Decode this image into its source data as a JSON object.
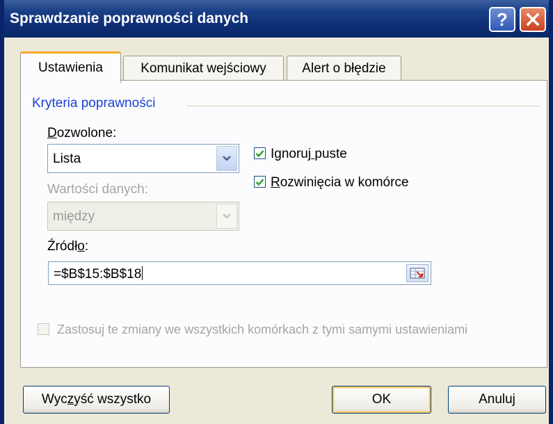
{
  "window": {
    "title": "Sprawdzanie poprawności danych",
    "help_icon": "help-icon",
    "close_icon": "close-icon"
  },
  "tabs": [
    {
      "label": "Ustawienia",
      "active": true
    },
    {
      "label": "Komunikat wejściowy",
      "active": false
    },
    {
      "label": "Alert o błędzie",
      "active": false
    }
  ],
  "criteria": {
    "group_title": "Kryteria poprawności",
    "allow_label": "Dozwolone:",
    "allow_value": "Lista",
    "data_label": "Wartości danych:",
    "data_value": "między",
    "ignore_blank_label": "Ignoruj puste",
    "ignore_blank_checked": true,
    "in_cell_dropdown_label": "Rozwinięcia w komórce",
    "in_cell_dropdown_checked": true,
    "source_label": "Źródło:",
    "source_value": "=$B$15:$B$18"
  },
  "apply_all": {
    "label": "Zastosuj te zmiany we wszystkich komórkach z tymi samymi ustawieniami",
    "checked": false
  },
  "buttons": {
    "clear_all": "Wyczyść wszystko",
    "ok": "OK",
    "cancel": "Anuluj"
  },
  "colors": {
    "title_bar": "#0a246a",
    "group_title": "#1a3fd6",
    "active_tab_accent": "#f4a72a",
    "close_button": "#c8421f"
  }
}
